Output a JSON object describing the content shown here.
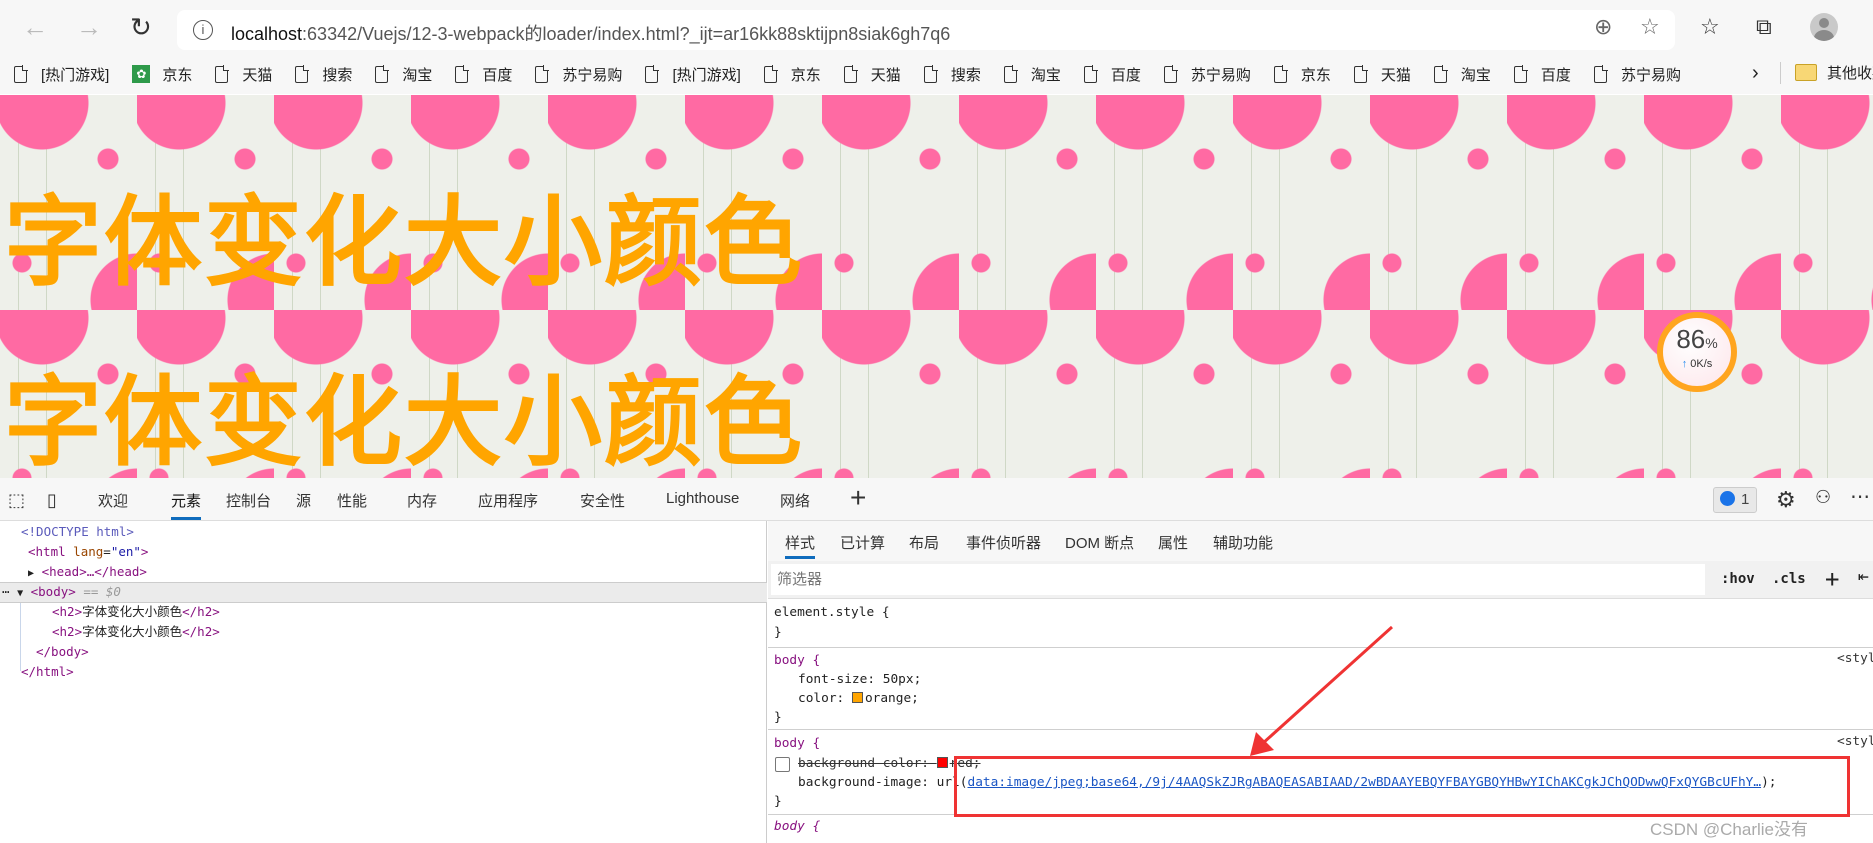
{
  "browser": {
    "url_host": "localhost",
    "url_rest": ":63342/Vuejs/12-3-webpack的loader/index.html?_ijt=ar16kk88sktijpn8siak6gh7q6",
    "icons": [
      "back-icon",
      "forward-icon",
      "reload-icon",
      "info-icon",
      "zoom-icon",
      "add-favorite-icon",
      "favorites-icon",
      "collections-icon",
      "profile-avatar"
    ]
  },
  "bookmarks": {
    "items": [
      "[热门游戏]",
      "京东",
      "天猫",
      "搜索",
      "淘宝",
      "百度",
      "苏宁易购",
      "[热门游戏]",
      "京东",
      "天猫",
      "搜索",
      "淘宝",
      "百度",
      "苏宁易购",
      "京东",
      "天猫",
      "淘宝",
      "百度",
      "苏宁易购"
    ],
    "other": "其他收藏"
  },
  "page": {
    "headings": [
      "字体变化大小颜色",
      "字体变化大小颜色"
    ],
    "heading_color": "#FFA500",
    "speed_widget": {
      "percent": "86",
      "percent_unit": "%",
      "rate": "0K/s"
    }
  },
  "devtools": {
    "tabs": [
      "欢迎",
      "元素",
      "控制台",
      "源",
      "性能",
      "内存",
      "应用程序",
      "安全性",
      "Lighthouse",
      "网络"
    ],
    "active_tab": "元素",
    "issues_count": "1",
    "dom": {
      "doctype": "<!DOCTYPE html>",
      "html_open": "<html",
      "lang_attr": "lang",
      "lang_val": "\"en\"",
      "head": "<head>…</head>",
      "body_open": "<body>",
      "body_marker": "== $0",
      "h2_open": "<h2>",
      "h2_text": "字体变化大小颜色",
      "h2_close": "</h2>",
      "body_close": "</body>",
      "html_close": "</html>"
    },
    "styles_tabs": [
      "样式",
      "已计算",
      "布局",
      "事件侦听器",
      "DOM 断点",
      "属性",
      "辅助功能"
    ],
    "filter_placeholder": "筛选器",
    "hov": ":hov",
    "cls": ".cls",
    "rules": {
      "element_style": "element.style {",
      "close": "}",
      "body": "body {",
      "font_size": "font-size: 50px;",
      "color_prop": "color: ",
      "color_val": "orange;",
      "bg_color_prop": "background-color: ",
      "bg_color_val": "red;",
      "bg_image_prop": "background-image: url(",
      "bg_image_val": "data:image/jpeg;base64,/9j/4AAQSkZJRgABAQEASABIAAD/2wBDAAYEBQYFBAYGBQYHBwYIChAKCgkJChQODwwQFxQYGBcUFhY…",
      "bg_image_end": ");",
      "source": "<styl",
      "body_next": "body {"
    }
  },
  "annotation": {
    "color": "#EF3333"
  },
  "watermark": "CSDN @Charlie没有"
}
